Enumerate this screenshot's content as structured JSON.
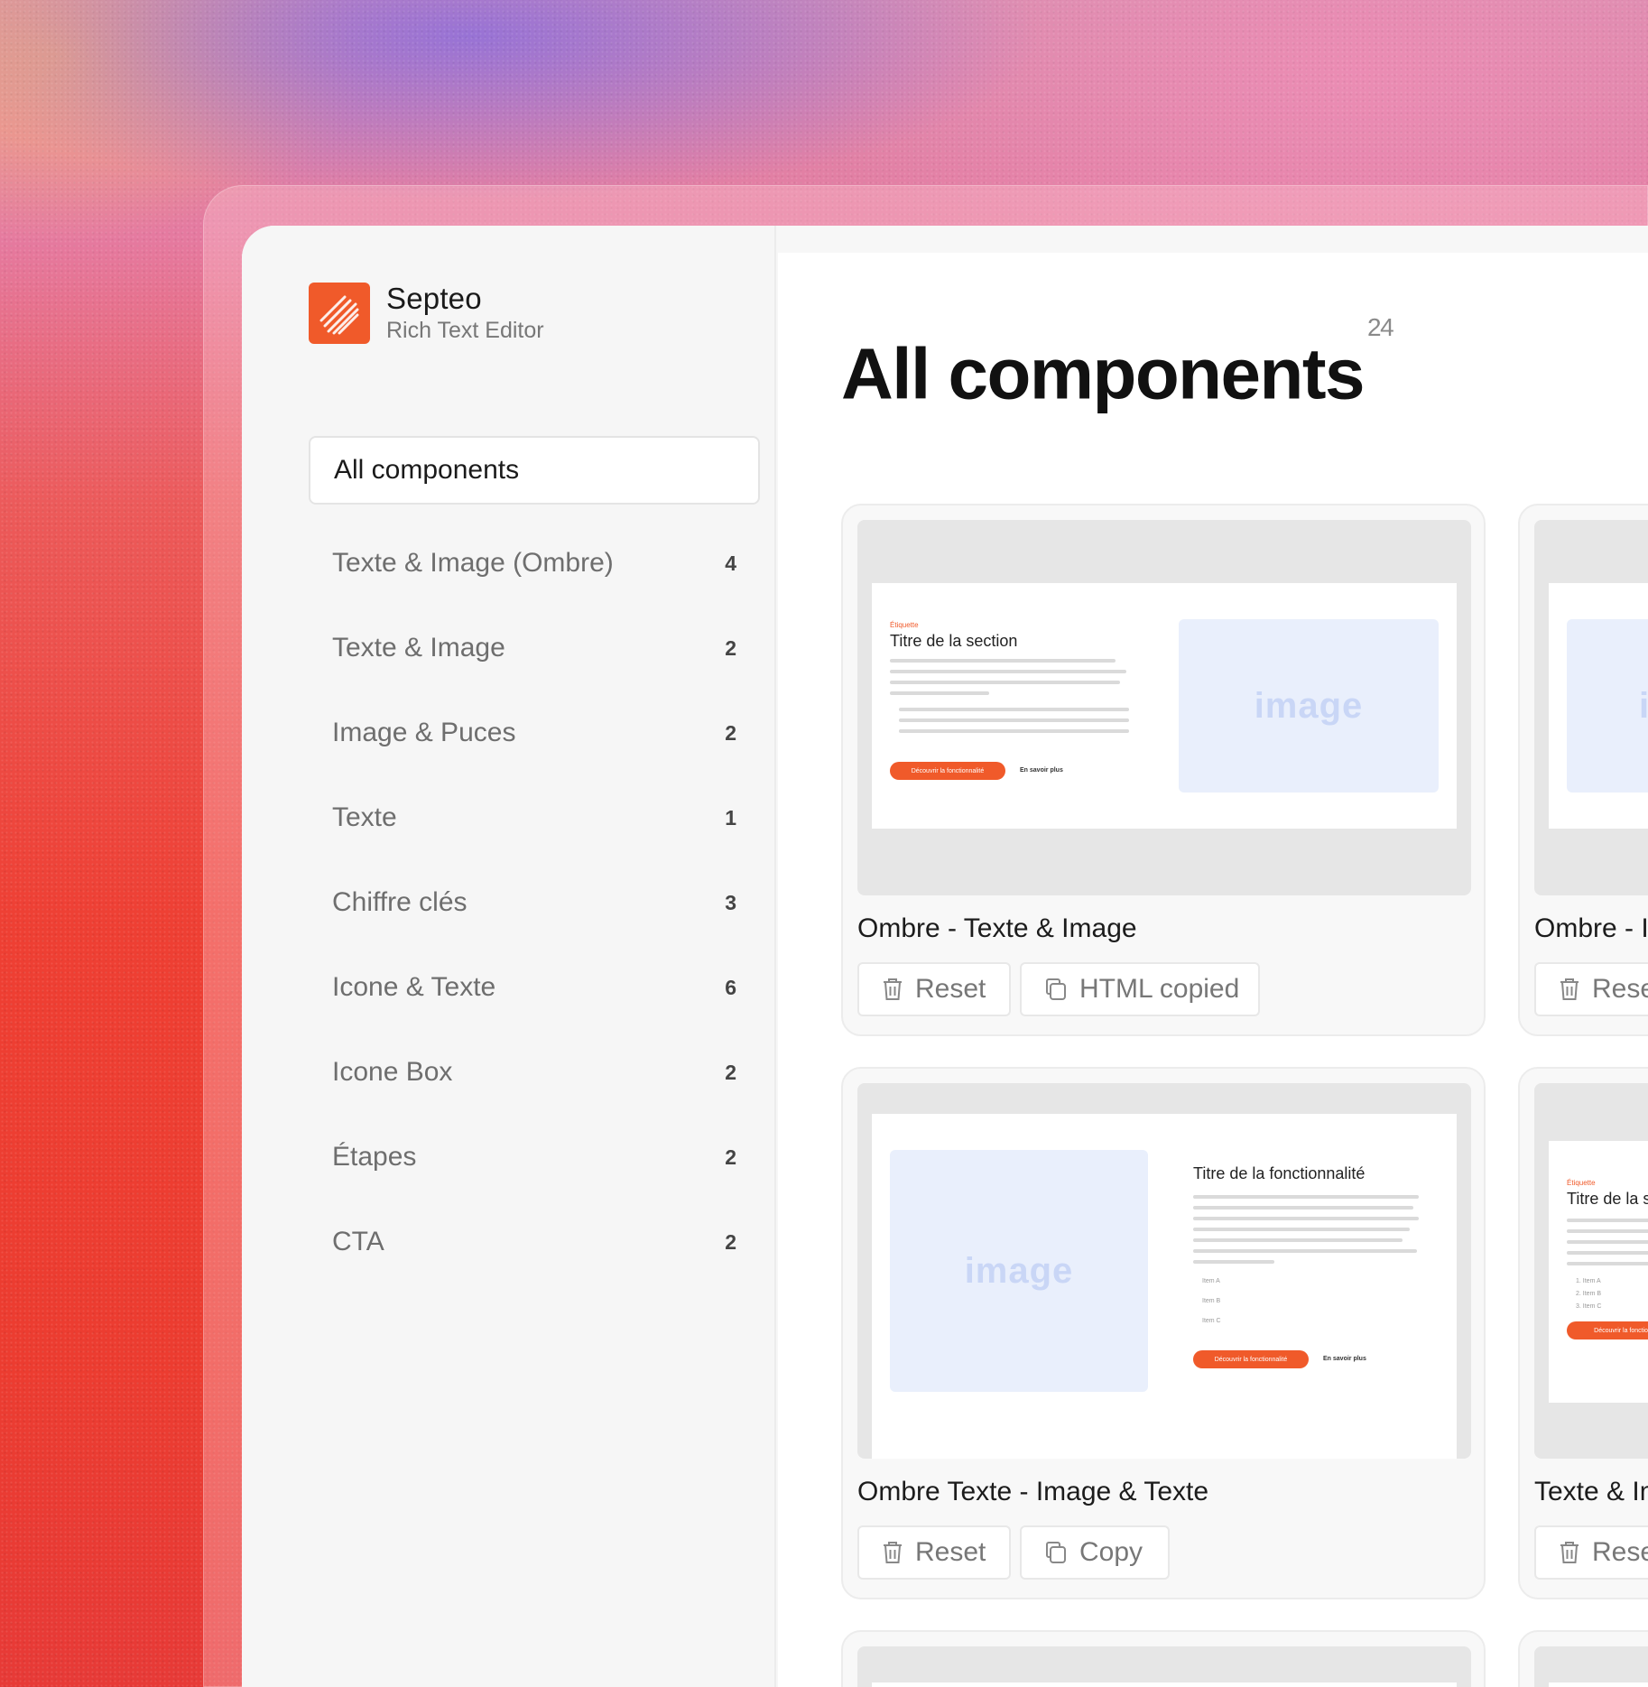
{
  "brand": {
    "name": "Septeo",
    "subtitle": "Rich Text Editor"
  },
  "sidebar": {
    "active": "All components",
    "items": [
      {
        "label": "Texte & Image (Ombre)",
        "count": "4"
      },
      {
        "label": "Texte & Image",
        "count": "2"
      },
      {
        "label": "Image & Puces",
        "count": "2"
      },
      {
        "label": "Texte",
        "count": "1"
      },
      {
        "label": "Chiffre clés",
        "count": "3"
      },
      {
        "label": "Icone & Texte",
        "count": "6"
      },
      {
        "label": "Icone Box",
        "count": "2"
      },
      {
        "label": "Étapes",
        "count": "2"
      },
      {
        "label": "CTA",
        "count": "2"
      }
    ]
  },
  "main": {
    "title": "All components",
    "count": "24"
  },
  "cards": [
    {
      "title": "Ombre - Texte & Image",
      "reset": "Reset",
      "copy": "HTML copied",
      "preview": {
        "tag": "Étiquette",
        "heading": "Titre de la section",
        "image": "image",
        "cta": "Découvrir la fonctionnalité",
        "link": "En savoir plus"
      }
    },
    {
      "title": "Ombre - I",
      "reset": "Rese",
      "preview": {
        "image": "i"
      }
    },
    {
      "title": "Ombre Texte - Image & Texte",
      "reset": "Reset",
      "copy": "Copy",
      "preview": {
        "heading": "Titre de la fonctionnalité",
        "image": "image",
        "bullets": [
          "Item A",
          "Item B",
          "Item C"
        ],
        "cta": "Découvrir la fonctionnalité",
        "link": "En savoir plus"
      }
    },
    {
      "title": "Texte & Im",
      "reset": "Rese",
      "preview": {
        "tag": "Étiquette",
        "heading": "Titre de la s",
        "items": [
          "1. Item A",
          "2. Item B",
          "3. Item C"
        ],
        "cta": "Découvrir la fonctionn"
      }
    }
  ],
  "colors": {
    "accent": "#f05a2a",
    "image_placeholder": "#e9effc"
  },
  "icons": {
    "reset": "trash-icon",
    "copy": "copy-icon"
  }
}
